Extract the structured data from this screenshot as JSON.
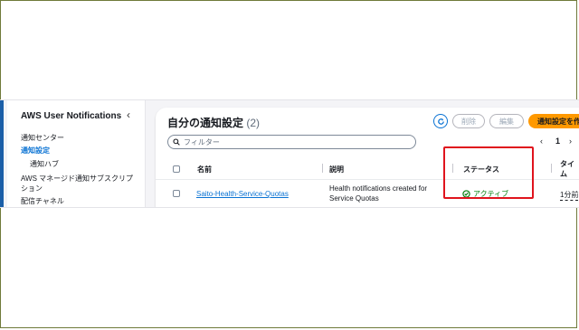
{
  "sidebar": {
    "title": "AWS User Notifications",
    "collapse_glyph": "‹",
    "items": [
      {
        "label": "通知センター"
      },
      {
        "label": "通知設定"
      },
      {
        "label": "通知ハブ"
      },
      {
        "label": "AWS マネージド通知サブスクリプ"
      },
      {
        "label": "ション"
      },
      {
        "label": "配信チャネル"
      }
    ]
  },
  "main": {
    "title": "自分の通知設定",
    "count": "(2)",
    "buttons": {
      "delete": "削除",
      "edit": "編集",
      "create": "通知設定を作"
    },
    "filter_placeholder": "フィルター",
    "pagination": {
      "prev": "‹",
      "page": "1",
      "next": "›"
    },
    "columns": [
      "名前",
      "説明",
      "ステータス",
      "タイム"
    ],
    "rows": [
      {
        "name": "Saito-Health-Service-Quotas",
        "description_line1": "Health notifications created for",
        "description_line2": "Service Quotas",
        "status": "アクティブ",
        "time": "1分前"
      }
    ]
  },
  "colors": {
    "accent": "#0972d3",
    "primary_button": "#ff9900",
    "status_active": "#037f0c",
    "highlight": "#e0141d"
  }
}
